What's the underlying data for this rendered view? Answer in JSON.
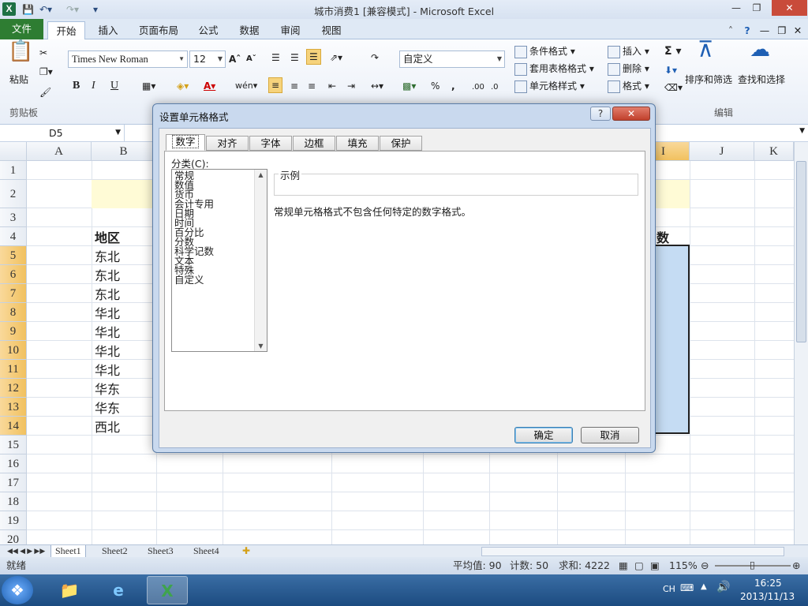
{
  "titlebar": {
    "title": "城市消费1  [兼容模式] - Microsoft Excel",
    "undo_icon": "undo-icon",
    "redo_icon": "redo-icon"
  },
  "ribbon_tabs": [
    "文件",
    "开始",
    "插入",
    "页面布局",
    "公式",
    "数据",
    "审阅",
    "视图"
  ],
  "ribbon": {
    "paste": "粘贴",
    "clipboard_label": "剪贴板",
    "font_name": "Times New Roman",
    "font_size": "12",
    "number_format": "自定义",
    "conditional_format": "条件格式",
    "table_format": "套用表格格式",
    "cell_style": "单元格样式",
    "insert": "插入",
    "delete": "删除",
    "format": "格式",
    "sort_filter": "排序和筛选",
    "find_select": "查找和选择",
    "editing_label": "编辑",
    "bold": "B",
    "italic": "I",
    "underline": "U",
    "sigma": "Σ"
  },
  "namebox": "D5",
  "columns": [
    "A",
    "B",
    "I",
    "J",
    "K"
  ],
  "rows": [
    "1",
    "2",
    "3",
    "4",
    "5",
    "6",
    "7",
    "8",
    "9",
    "10",
    "11",
    "12",
    "13",
    "14",
    "15",
    "16",
    "17",
    "18",
    "19",
    "20"
  ],
  "cells": {
    "header_b4": "地区",
    "header_i4": "数",
    "region": [
      "东北",
      "东北",
      "东北",
      "华北",
      "华北",
      "华北",
      "华北",
      "华东",
      "华东",
      "西北"
    ]
  },
  "sheets": [
    "Sheet1",
    "Sheet2",
    "Sheet3",
    "Sheet4"
  ],
  "status": {
    "ready": "就绪",
    "average": "平均值: 90",
    "count": "计数: 50",
    "sum": "求和: 4222",
    "zoom": "115%"
  },
  "taskbar": {
    "lang": "CH",
    "time": "16:25",
    "date": "2013/11/13"
  },
  "dialog": {
    "title": "设置单元格格式",
    "help": "?",
    "tabs": [
      "数字",
      "对齐",
      "字体",
      "边框",
      "填充",
      "保护"
    ],
    "category_label": "分类(C):",
    "categories": [
      "常规",
      "数值",
      "货币",
      "会计专用",
      "日期",
      "时间",
      "百分比",
      "分数",
      "科学记数",
      "文本",
      "特殊",
      "自定义"
    ],
    "sample_label": "示例",
    "description": "常规单元格格式不包含任何特定的数字格式。",
    "ok": "确定",
    "cancel": "取消"
  }
}
